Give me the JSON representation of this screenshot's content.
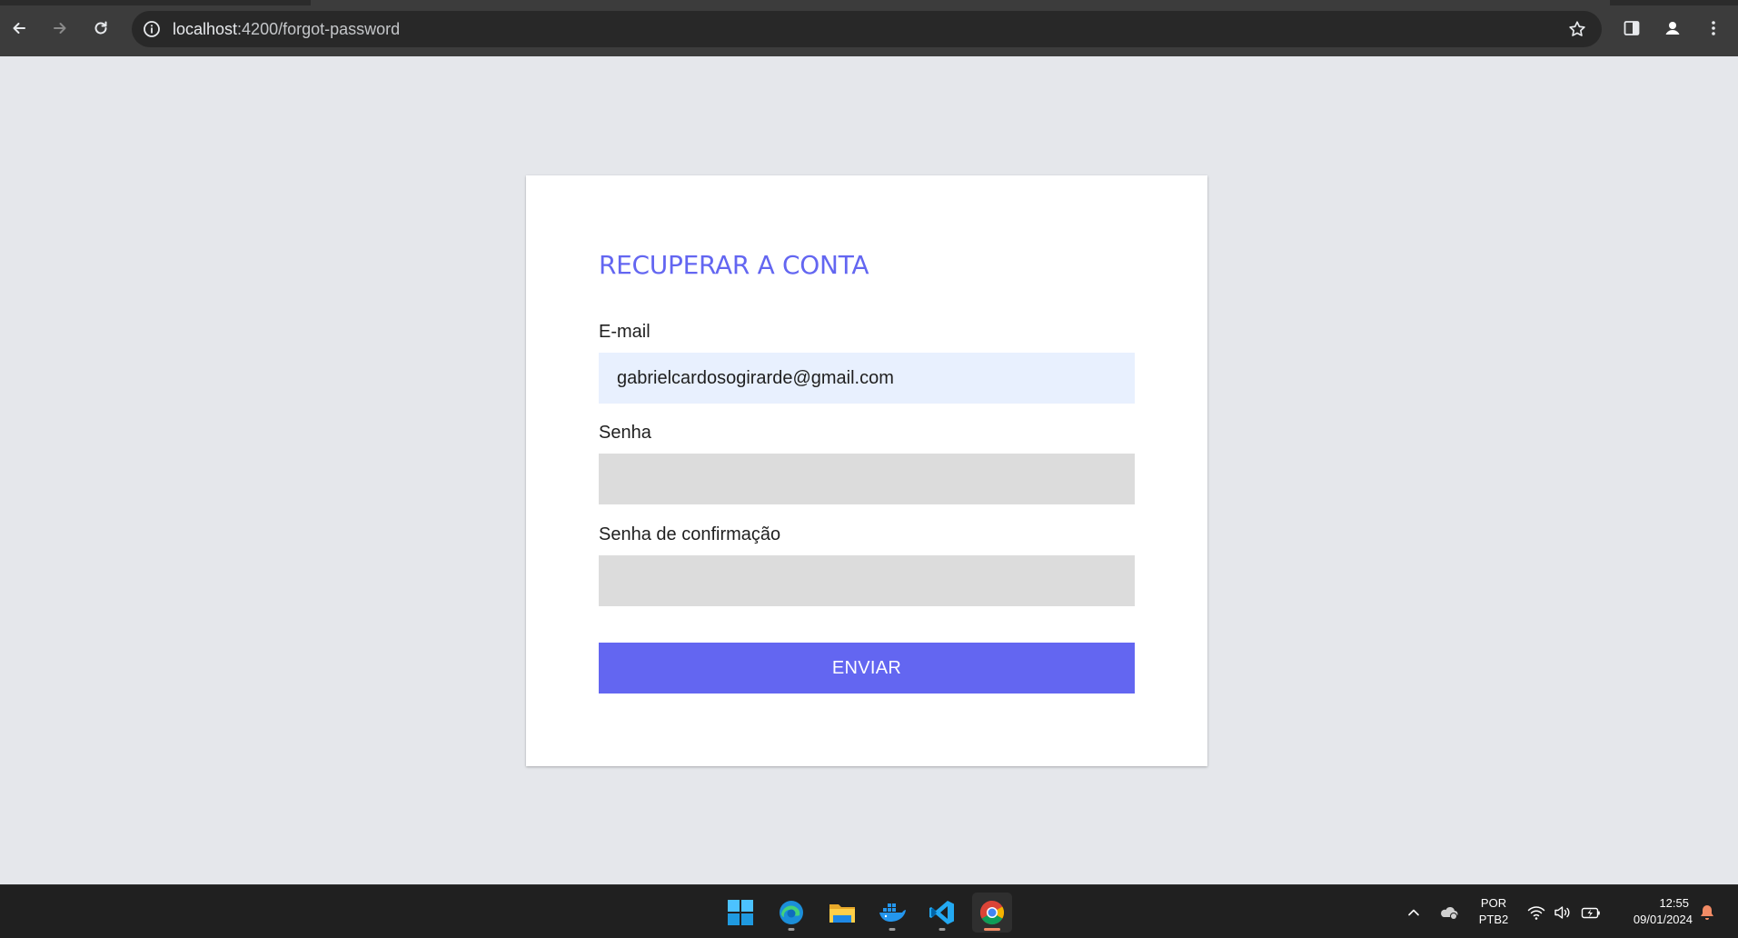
{
  "browser": {
    "url_host": "localhost",
    "url_path": ":4200/forgot-password",
    "icons": [
      "back-arrow-icon",
      "forward-arrow-icon",
      "reload-icon",
      "info-icon",
      "star-icon",
      "side-panel-icon",
      "profile-icon",
      "menu-dots-icon"
    ]
  },
  "form": {
    "title": "RECUPERAR A CONTA",
    "email_label": "E-mail",
    "email_value": "gabrielcardosogirarde@gmail.com",
    "password_label": "Senha",
    "password_value": "",
    "confirm_label": "Senha de confirmação",
    "confirm_value": "",
    "submit_label": "ENVIAR"
  },
  "taskbar": {
    "apps": [
      "windows-start-icon",
      "edge-icon",
      "file-explorer-icon",
      "docker-icon",
      "vscode-icon",
      "chrome-icon"
    ],
    "language_top": "POR",
    "language_bottom": "PTB2",
    "time": "12:55",
    "date": "09/01/2024"
  },
  "colors": {
    "accent": "#6366f1",
    "page_background": "#e5e7eb",
    "input_background": "#dcdcdc",
    "autofill_background": "#e8f0fe"
  }
}
